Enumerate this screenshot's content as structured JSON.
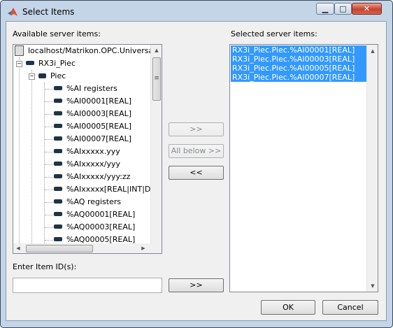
{
  "window": {
    "title": "Select Items",
    "minimize_glyph": "▁",
    "maximize_glyph": "□",
    "close_glyph": "✕"
  },
  "available": {
    "label": "Available server items:",
    "tree": [
      {
        "text": "localhost/Matrikon.OPC.Universa",
        "icon": "server-icon"
      },
      {
        "text": "RX3i_Piec",
        "icon": "device-icon"
      },
      {
        "text": "Piec",
        "icon": "folder-icon"
      },
      {
        "text": "%AI registers",
        "icon": "tag-icon"
      },
      {
        "text": "%AI00001[REAL]",
        "icon": "tag-icon"
      },
      {
        "text": "%AI00003[REAL]",
        "icon": "tag-icon"
      },
      {
        "text": "%AI00005[REAL]",
        "icon": "tag-icon"
      },
      {
        "text": "%AI00007[REAL]",
        "icon": "tag-icon"
      },
      {
        "text": "%AIxxxxx.yyy",
        "icon": "tag-icon"
      },
      {
        "text": "%AIxxxxx/yyy",
        "icon": "tag-icon"
      },
      {
        "text": "%AIxxxxx/yyy:zz",
        "icon": "tag-icon"
      },
      {
        "text": "%AIxxxxx[REAL|INT|DIN",
        "icon": "tag-icon"
      },
      {
        "text": "%AQ registers",
        "icon": "tag-icon"
      },
      {
        "text": "%AQ00001[REAL]",
        "icon": "tag-icon"
      },
      {
        "text": "%AQ00003[REAL]",
        "icon": "tag-icon"
      },
      {
        "text": "%AQ00005[REAL]",
        "icon": "tag-icon"
      }
    ]
  },
  "selected": {
    "label": "Selected server items:",
    "items": [
      "RX3i_Piec.Piec.%AI00001[REAL]",
      "RX3i_Piec.Piec.%AI00003[REAL]",
      "RX3i_Piec.Piec.%AI00005[REAL]",
      "RX3i_Piec.Piec.%AI00007[REAL]"
    ]
  },
  "buttons": {
    "add": ">>",
    "all_below": "All below >>",
    "remove": "<<",
    "add_id": ">>",
    "ok": "OK",
    "cancel": "Cancel"
  },
  "item_id": {
    "label": "Enter Item ID(s):",
    "value": ""
  },
  "scroll": {
    "up": "▲",
    "down": "▼",
    "left": "◀",
    "right": "▶",
    "grip": "≡"
  }
}
